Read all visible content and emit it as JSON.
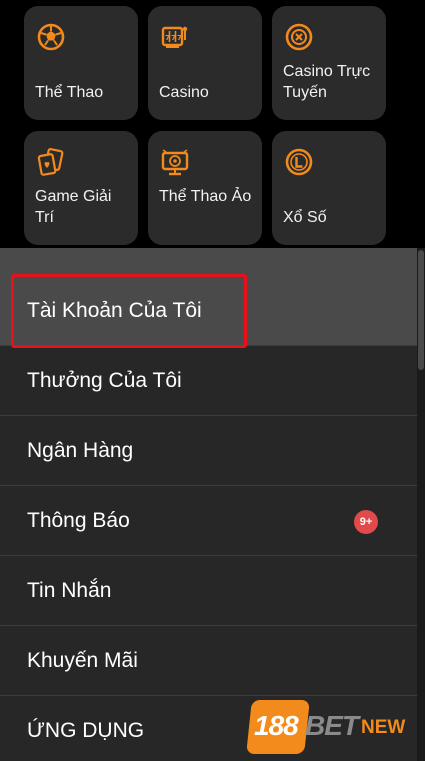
{
  "colors": {
    "accent": "#f28a1c",
    "tile_bg": "#2b2b2b",
    "menu_bg": "#272727",
    "active_bg": "#4a4a4a",
    "highlight": "#e8101a",
    "badge": "#e04a4a"
  },
  "products": [
    {
      "label": "Thể Thao",
      "icon": "soccer-ball-icon"
    },
    {
      "label": "Casino",
      "icon": "slot-machine-icon"
    },
    {
      "label": "Casino Trực Tuyến",
      "icon": "casino-chip-icon"
    },
    {
      "label": "Game Giải Trí",
      "icon": "playing-cards-icon"
    },
    {
      "label": "Thể Thao Ảo",
      "icon": "virtual-sports-monitor-icon"
    },
    {
      "label": "Xổ Số",
      "icon": "lottery-ball-icon"
    }
  ],
  "menu": [
    {
      "label": "Tài Khoản Của Tôi"
    },
    {
      "label": "Thưởng Của Tôi"
    },
    {
      "label": "Ngân Hàng"
    },
    {
      "label": "Thông Báo",
      "badge": "9+"
    },
    {
      "label": "Tin Nhắn"
    },
    {
      "label": "Khuyến Mãi"
    },
    {
      "label": "ỨNG DỤNG"
    }
  ],
  "logo": {
    "number": "188",
    "brand": "BET",
    "suffix": "NEW"
  }
}
